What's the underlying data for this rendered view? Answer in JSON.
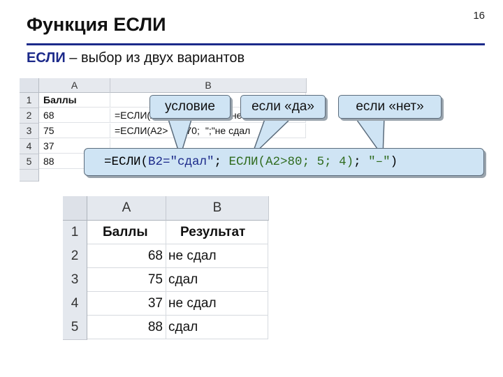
{
  "slide": {
    "page_number": "16",
    "title": "Функция ЕСЛИ",
    "subtitle_keyword": "ЕСЛИ",
    "subtitle_rest": " – выбор из двух вариантов"
  },
  "sheet_top": {
    "columns": [
      "A",
      "B"
    ],
    "rows": [
      {
        "num": "1",
        "a": "Баллы",
        "b": ""
      },
      {
        "num": "2",
        "a": "68",
        "b": "=ЕСЛИ(A2>"
      },
      {
        "num": "3",
        "a": "75",
        "b": "=ЕСЛИ(A2>"
      },
      {
        "num": "4",
        "a": "37",
        "b": ""
      },
      {
        "num": "5",
        "a": "88",
        "b": ""
      }
    ],
    "b2_tail": "...;\"не сдал\"",
    "b3_mid": "70;",
    "b3_tail": "\";\"не сдал"
  },
  "callouts": {
    "condition": "условие",
    "if_yes": "если «да»",
    "if_no": "если «нет»"
  },
  "formula": {
    "part1": "=ЕСЛИ(",
    "part2": "B2=\"сдал\"",
    "part3": "; ",
    "part4": "ЕСЛИ(A2>80; 5; 4)",
    "part5": "; ",
    "part6": "\"–\"",
    "part7": ")"
  },
  "sheet_bottom": {
    "columns": [
      "A",
      "B"
    ],
    "header_row": {
      "num": "1",
      "a": "Баллы",
      "b": "Результат"
    },
    "rows": [
      {
        "num": "2",
        "a": "68",
        "b": "не сдал"
      },
      {
        "num": "3",
        "a": "75",
        "b": "сдал"
      },
      {
        "num": "4",
        "a": "37",
        "b": "не сдал"
      },
      {
        "num": "5",
        "a": "88",
        "b": "сдал"
      }
    ]
  },
  "colors": {
    "accent": "#1c2a8a",
    "callout_fill": "#cfe4f4",
    "formula_green": "#2f6b1e"
  }
}
